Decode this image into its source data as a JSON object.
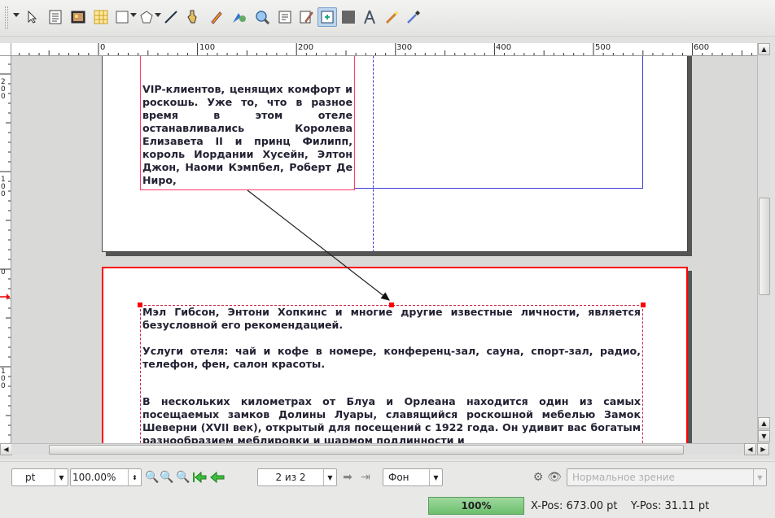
{
  "toolbar": {
    "icons": [
      "select-arrow-icon",
      "text-frame-icon",
      "image-frame-icon",
      "table-icon",
      "shape-icon",
      "polygon-icon",
      "line-icon",
      "bezier-icon",
      "freehand-icon",
      "rotate-icon",
      "zoom-icon",
      "edit-contents-icon",
      "edit-text-icon",
      "link-frames-icon",
      "unlink-frames-icon",
      "measure-icon",
      "copy-properties-icon",
      "eyedropper-icon"
    ]
  },
  "ruler": {
    "top_labels": [
      "0",
      "100",
      "200",
      "300",
      "400",
      "500",
      "600"
    ],
    "left_labels": [
      "200",
      "100",
      "0",
      "100"
    ]
  },
  "document": {
    "frame1_text": "VIP-клиентов, ценящих комфорт и роскошь. Уже то, что в разное время в этом отеле останавливались Королева Елизавета II и принц Филипп, король Иордании Хусейн, Элтон Джон, Наоми Кэмпбел, Роберт Де Ниро,",
    "frame2_p1": "Мэл Гибсон, Энтони Хопкинс и многие другие известные личности, является безусловной его рекомендацией.",
    "frame2_p2": "Услуги отеля: чай и кофе в номере, конференц-зал, сауна, спорт-зал, радио, телефон, фен, салон красоты.",
    "frame2_p3": "В нескольких километрах от Блуа и Орлеана находится один из самых посещаемых замков Долины Луары, славящийся роскошной мебелью Замок Шеверни (XVII век), открытый для посещений с 1922 года. Он удивит вас богатым разнообразием меблировки и шармом подлинности и"
  },
  "bottombar": {
    "unit": "pt",
    "zoom": "100.00%",
    "page": "2 из 2",
    "layer": "Фон",
    "view_mode": "Нормальное зрение"
  },
  "status": {
    "progress": "100%",
    "xpos": "X-Pos: 673.00 pt",
    "ypos": "Y-Pos: 31.11 pt"
  },
  "colors": {
    "frame_selected": "#ff0000",
    "frame_normal": "#ff3b6b",
    "margin_guide": "#3c3cd8",
    "progress": "#78c878"
  }
}
